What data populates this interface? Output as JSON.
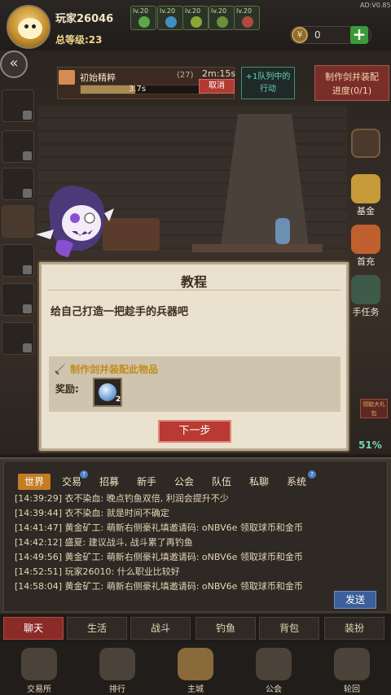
{
  "header": {
    "player_name": "玩家26046",
    "total_level": "总等级:23",
    "version": "AD:V0.85",
    "skill_levels": [
      "lv.20",
      "lv.20",
      "lv.20",
      "lv.20",
      "lv.20"
    ],
    "coins": "0"
  },
  "task": {
    "name": "初始精粹",
    "count": "(27)",
    "rate": "3.7s",
    "timer": "2m:15s",
    "progress": 0.45,
    "cancel_label": "取消",
    "queue_label_1": "+1队列中的",
    "queue_label_2": "行动",
    "goal_line_1": "制作剑并装配",
    "goal_line_2": "进度(0/1)"
  },
  "right_rail": {
    "fund": "基金",
    "first_charge": "首充",
    "task_hint": "手任务",
    "promo": "领取大礼包",
    "percent": "51%"
  },
  "dialog": {
    "title": "教程",
    "text": "给自己打造一把趁手的兵器吧",
    "task": "制作剑并装配此物品",
    "reward_label": "奖励:",
    "reward_qty": "2",
    "next_label": "下一步"
  },
  "chat": {
    "tabs": [
      "世界",
      "交易",
      "招募",
      "新手",
      "公会",
      "队伍",
      "私聊",
      "系统"
    ],
    "messages": [
      {
        "time": "[14:39:29]",
        "text": "衣不染血: 晚点钓鱼双倍, 利润会提升不少"
      },
      {
        "time": "[14:39:44]",
        "text": "衣不染血: 就是时间不确定"
      },
      {
        "time": "[14:41:47]",
        "text": "黄金矿工: 萌新右侧豪礼填邀请码: oNBV6e 领取球币和金币"
      },
      {
        "time": "[14:42:12]",
        "text": "盛夏: 建议战斗, 战斗累了再钓鱼"
      },
      {
        "time": "[14:49:56]",
        "text": "黄金矿工: 萌新右侧豪礼填邀请码: oNBV6e 领取球币和金币"
      },
      {
        "time": "[14:52:51]",
        "text": "玩家26010: 什么职业比较好"
      },
      {
        "time": "[14:58:04]",
        "text": "黄金矿工: 萌新右侧豪礼填邀请码: oNBV6e 领取球币和金币"
      }
    ],
    "send_label": "发送"
  },
  "bottom_tabs": [
    "聊天",
    "生活",
    "战斗",
    "钓鱼",
    "背包",
    "装扮"
  ],
  "nav": [
    "交易所",
    "排行",
    "主城",
    "公会",
    "轮回"
  ],
  "colors": {
    "accent": "#b83a33",
    "gold": "#c47c25",
    "teal": "#3e8f77"
  }
}
